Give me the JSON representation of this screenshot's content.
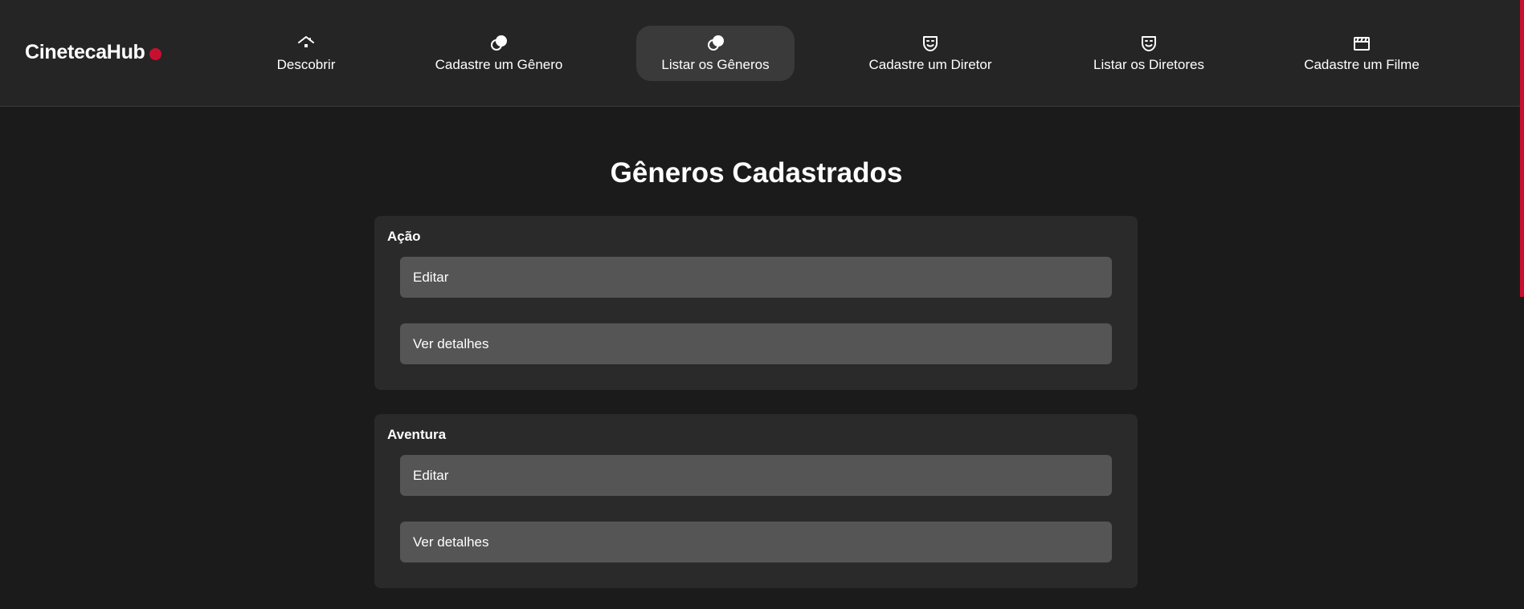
{
  "app": {
    "logo_text": "CinetecaHub",
    "brand_color": "#c8102e"
  },
  "nav": {
    "items": [
      {
        "label": "Descobrir",
        "icon": "home-icon",
        "active": false
      },
      {
        "label": "Cadastre um Gênero",
        "icon": "genre-icon",
        "active": false
      },
      {
        "label": "Listar os Gêneros",
        "icon": "genre-icon",
        "active": true
      },
      {
        "label": "Cadastre um Diretor",
        "icon": "mask-icon",
        "active": false
      },
      {
        "label": "Listar os Diretores",
        "icon": "mask-icon",
        "active": false
      },
      {
        "label": "Cadastre um Filme",
        "icon": "clapperboard-icon",
        "active": false
      }
    ]
  },
  "main": {
    "title": "Gêneros Cadastrados",
    "genres": [
      {
        "name": "Ação",
        "edit_label": "Editar",
        "details_label": "Ver detalhes"
      },
      {
        "name": "Aventura",
        "edit_label": "Editar",
        "details_label": "Ver detalhes"
      }
    ]
  }
}
